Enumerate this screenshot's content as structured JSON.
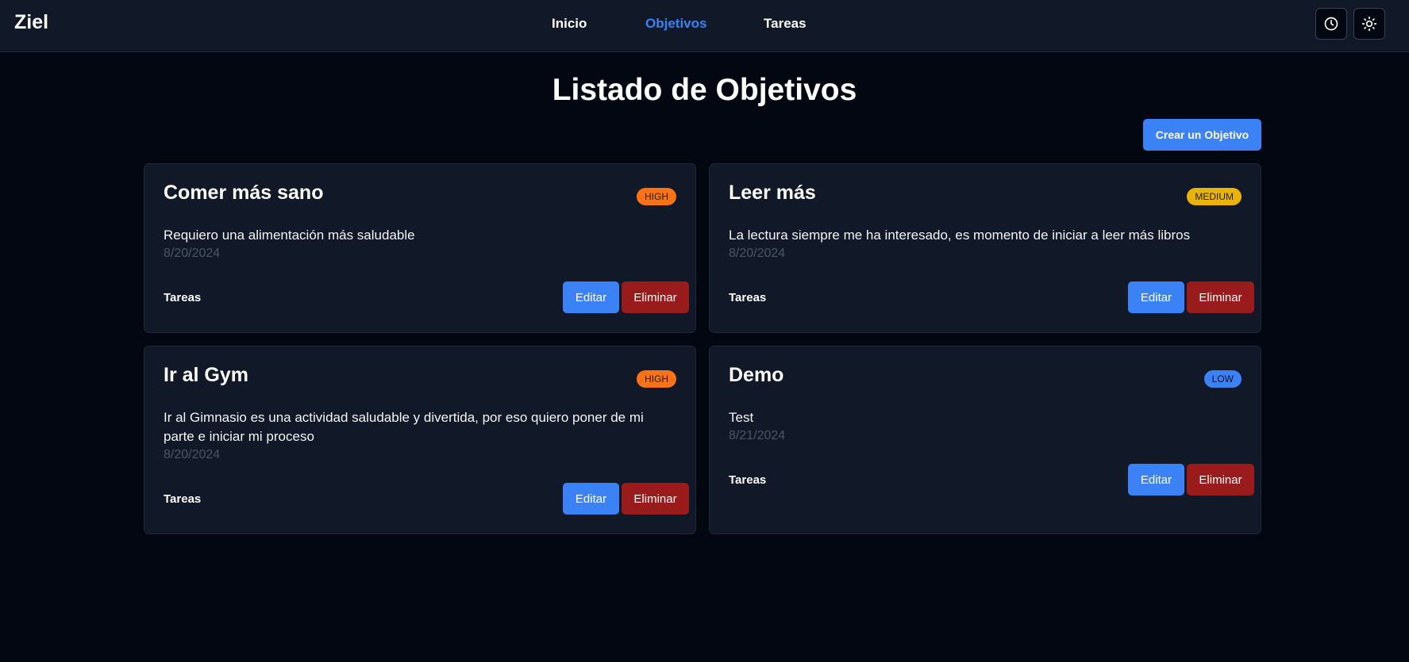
{
  "app": {
    "brand": "Ziel"
  },
  "nav": {
    "items": [
      {
        "label": "Inicio",
        "active": false
      },
      {
        "label": "Objetivos",
        "active": true
      },
      {
        "label": "Tareas",
        "active": false
      }
    ],
    "icons": {
      "history": "clock-icon",
      "theme": "sun-icon"
    }
  },
  "colors": {
    "background": "#030712",
    "surface": "#111827",
    "accent": "#3b82f6",
    "danger": "#991b1b",
    "priority_high": "#f97316",
    "priority_medium": "#eab308",
    "priority_low": "#3b82f6"
  },
  "page": {
    "title": "Listado de Objetivos",
    "create_button": "Crear un Objetivo"
  },
  "goals": [
    {
      "title": "Comer más sano",
      "priority": "HIGH",
      "description": "Requiero una alimentación más saludable",
      "date": "8/20/2024",
      "tasks_link": "Tareas",
      "edit_label": "Editar",
      "delete_label": "Eliminar"
    },
    {
      "title": "Leer más",
      "priority": "MEDIUM",
      "description": "La lectura siempre me ha interesado, es momento de iniciar a leer más libros",
      "date": "8/20/2024",
      "tasks_link": "Tareas",
      "edit_label": "Editar",
      "delete_label": "Eliminar"
    },
    {
      "title": "Ir al Gym",
      "priority": "HIGH",
      "description": "Ir al Gimnasio es una actividad saludable y divertida, por eso quiero poner de mi parte e iniciar mi proceso",
      "date": "8/20/2024",
      "tasks_link": "Tareas",
      "edit_label": "Editar",
      "delete_label": "Eliminar"
    },
    {
      "title": "Demo",
      "priority": "LOW",
      "description": "Test",
      "date": "8/21/2024",
      "tasks_link": "Tareas",
      "edit_label": "Editar",
      "delete_label": "Eliminar"
    }
  ]
}
